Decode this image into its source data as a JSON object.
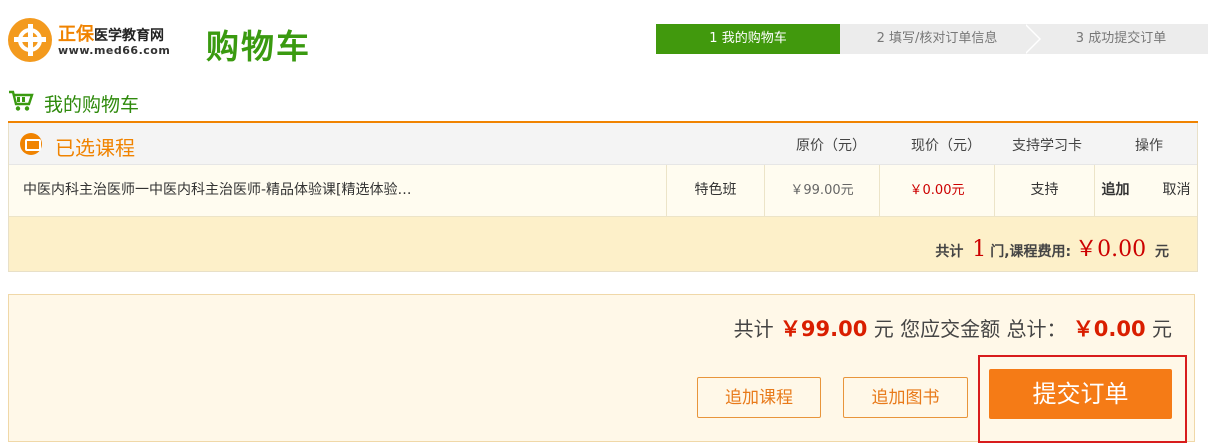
{
  "header": {
    "logo": {
      "brand_cn": "正保",
      "brand_sub": "医学教育网",
      "url": "www.med66.com"
    },
    "title": "购物车",
    "steps": [
      {
        "label": "1 我的购物车",
        "active": true
      },
      {
        "label": "2 填写/核对订单信息",
        "active": false
      },
      {
        "label": "3 成功提交订单",
        "active": false
      }
    ]
  },
  "section": {
    "title": "我的购物车"
  },
  "cart_table": {
    "group_title": "已选课程",
    "columns": {
      "original_price": "原价（元）",
      "current_price": "现价（元）",
      "study_card": "支持学习卡",
      "actions": "操作"
    },
    "rows": [
      {
        "name": "中医内科主治医师一中医内科主治医师-精品体验课[精选体验…",
        "type": "特色班",
        "original_price": "￥99.00元",
        "current_price": "￥0.00元",
        "study_card": "支持",
        "action_add": "追加",
        "action_cancel": "取消"
      }
    ],
    "footer": {
      "prefix": "共计",
      "count": "1",
      "middle": "门,课程费用:",
      "amount": "￥0.00",
      "unit": "元"
    }
  },
  "summary": {
    "prefix": "共计",
    "total": "￥99.00",
    "middle": "元 您应交金额 总计：",
    "payable": "￥0.00",
    "unit": "元",
    "buttons": {
      "add_course": "追加课程",
      "add_book": "追加图书",
      "submit": "提交订单"
    }
  },
  "colors": {
    "brand_green": "#41990d",
    "accent_orange": "#f08300",
    "price_red": "#d91e00",
    "submit_bg": "#f57b16"
  },
  "icons": [
    "logo-mark-icon",
    "cart-icon",
    "tv-icon"
  ]
}
